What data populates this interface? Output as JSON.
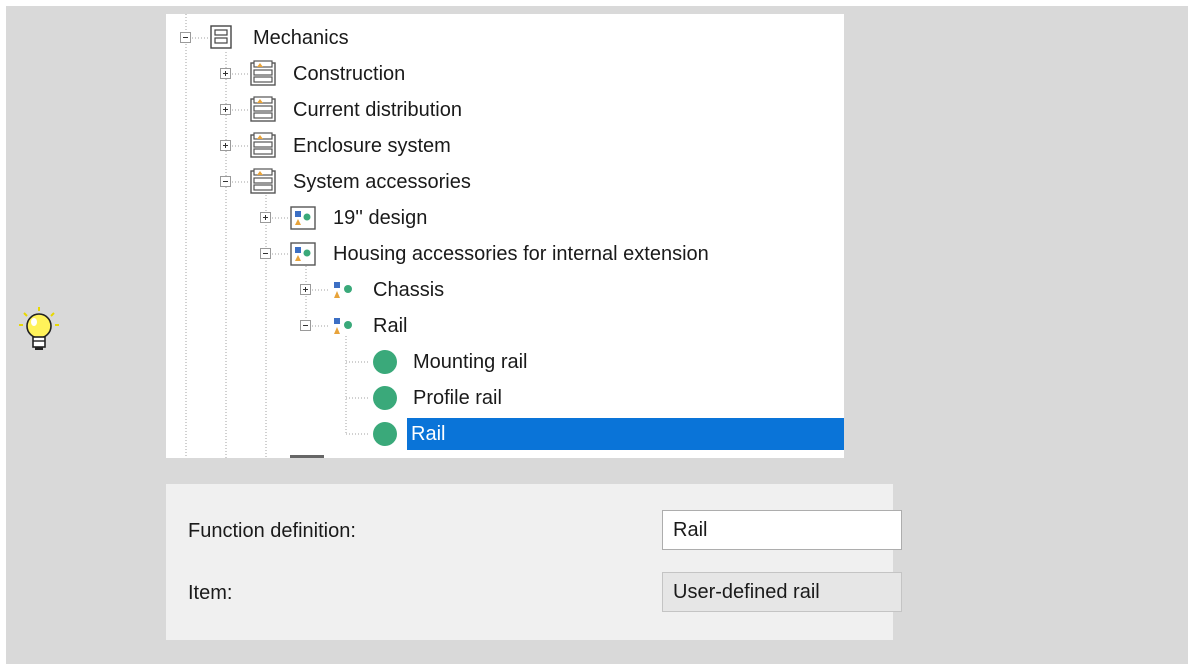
{
  "tree": {
    "items": [
      {
        "label": "Mechanics",
        "icon": "structure-icon",
        "state": "expanded"
      },
      {
        "label": "Construction",
        "icon": "folder-group-icon",
        "state": "collapsed"
      },
      {
        "label": "Current distribution",
        "icon": "folder-group-icon",
        "state": "collapsed"
      },
      {
        "label": "Enclosure system",
        "icon": "folder-group-icon",
        "state": "collapsed"
      },
      {
        "label": "System accessories",
        "icon": "folder-group-icon",
        "state": "expanded"
      },
      {
        "label": "19'' design",
        "icon": "function-category-icon",
        "state": "collapsed"
      },
      {
        "label": "Housing accessories for internal extension",
        "icon": "function-category-icon",
        "state": "expanded"
      },
      {
        "label": "Chassis",
        "icon": "function-group-icon",
        "state": "collapsed"
      },
      {
        "label": "Rail",
        "icon": "function-group-icon",
        "state": "expanded"
      },
      {
        "label": "Mounting rail",
        "icon": "function-dot-icon",
        "state": "leaf"
      },
      {
        "label": "Profile rail",
        "icon": "function-dot-icon",
        "state": "leaf"
      },
      {
        "label": "Rail",
        "icon": "function-dot-icon",
        "state": "leaf-selected"
      }
    ]
  },
  "properties": {
    "function_definition_label": "Function definition:",
    "function_definition_value": "Rail",
    "item_label": "Item:",
    "item_value": "User-defined rail"
  },
  "colors": {
    "selection": "#0a74d8",
    "function_dot": "#3aa97a",
    "frame": "#d9d9d9"
  },
  "tip_icon": "lightbulb-icon"
}
